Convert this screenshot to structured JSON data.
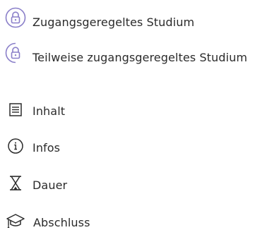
{
  "access_legend": {
    "items": [
      {
        "label": "Zugangsgeregeltes Studium",
        "icon": "lock-full-circle-icon",
        "color": "#8a7fc9"
      },
      {
        "label": "Teilweise zugangsgeregeltes Studium",
        "icon": "lock-half-circle-icon",
        "color": "#8a7fc9"
      }
    ]
  },
  "menu": {
    "items": [
      {
        "label": "Inhalt",
        "icon": "document-lines-icon"
      },
      {
        "label": "Infos",
        "icon": "info-circle-icon"
      },
      {
        "label": "Dauer",
        "icon": "hourglass-icon"
      },
      {
        "label": "Abschluss",
        "icon": "graduation-cap-icon"
      }
    ]
  }
}
